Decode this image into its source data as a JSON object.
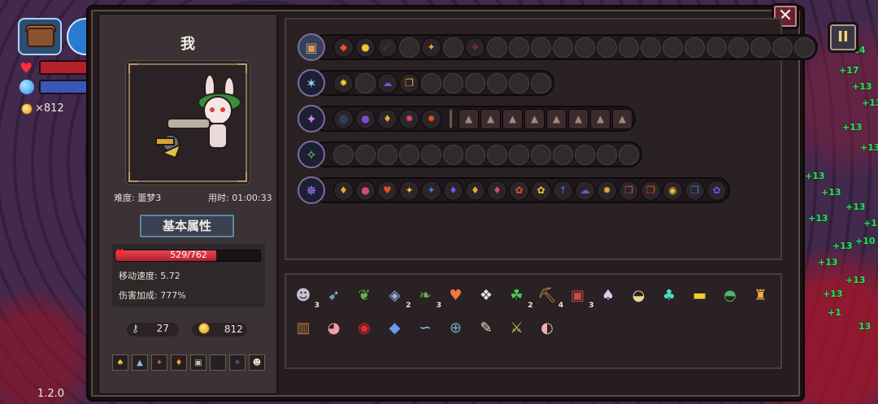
{
  "hud": {
    "gold_count": "×812",
    "version": "1.2.0"
  },
  "rain_numbers": [
    "+14",
    "+17",
    "+13",
    "+13",
    "+13",
    "+13",
    "+13",
    "+13",
    "+13",
    "+13",
    "+13",
    "+13",
    "+10",
    "+13",
    "+13",
    "+13",
    "+1",
    "13",
    "13"
  ],
  "panel": {
    "close_symbol": "✕",
    "pause_symbol": "II"
  },
  "player": {
    "name": "我",
    "difficulty": "难度: 噩梦3",
    "time": "用时: 01:00:33",
    "attr_title": "基本属性",
    "hp_text": "529/762",
    "hp_fraction": 0.694,
    "move_speed": "移动速度: 5.72",
    "damage_bonus": "伤害加成: 777%",
    "keys": "27",
    "gold": "812"
  },
  "weapon_rows": [
    {
      "weapon": "chest-icon",
      "slots": [
        "◆",
        "●",
        "☄",
        "",
        "✦",
        "",
        "✧",
        "",
        "",
        "",
        "",
        "",
        "",
        "",
        "",
        "",
        "",
        "",
        "",
        "",
        "",
        ""
      ]
    },
    {
      "weapon": "staff-frost-icon",
      "slots": [
        "✸",
        "",
        "☁",
        "❐",
        "",
        "",
        "",
        "",
        "",
        ""
      ]
    },
    {
      "weapon": "wand-shadow-icon",
      "slots": [
        "◎",
        "●",
        "♦",
        "✹",
        "✹"
      ],
      "buffs": [
        "▲",
        "▲",
        "▲",
        "▲",
        "▲",
        "▲",
        "▲",
        "▲"
      ]
    },
    {
      "weapon": "staff-nature-icon",
      "slots": [
        "",
        "",
        "",
        "",
        "",
        "",
        "",
        "",
        "",
        "",
        "",
        "",
        "",
        ""
      ]
    },
    {
      "weapon": "staff-arcane-icon",
      "slots": [
        "♦",
        "●",
        "♥",
        "✦",
        "✦",
        "♦",
        "♦",
        "♦",
        "✿",
        "✿",
        "↑",
        "☁",
        "✹",
        "❐",
        "❐",
        "◉",
        "❐",
        "✿"
      ]
    }
  ],
  "items": [
    {
      "icon": "skull-bomb-icon",
      "glyph": "☻",
      "count": "3"
    },
    {
      "icon": "arrow-icon",
      "glyph": "➶",
      "count": ""
    },
    {
      "icon": "green-pepper-icon",
      "glyph": "❦",
      "count": ""
    },
    {
      "icon": "crystal-icon",
      "glyph": "◈",
      "count": "2"
    },
    {
      "icon": "leaf-icon",
      "glyph": "❧",
      "count": "3"
    },
    {
      "icon": "heart-icon",
      "glyph": "♥",
      "count": ""
    },
    {
      "icon": "crystal-shard-icon",
      "glyph": "❖",
      "count": ""
    },
    {
      "icon": "clover-icon",
      "glyph": "☘",
      "count": "2"
    },
    {
      "icon": "pickaxe-icon",
      "glyph": "⛏",
      "count": "4"
    },
    {
      "icon": "crate-icon",
      "glyph": "▣",
      "count": "3"
    },
    {
      "icon": "mask-icon",
      "glyph": "♠",
      "count": ""
    },
    {
      "icon": "bread-icon",
      "glyph": "◒",
      "count": ""
    },
    {
      "icon": "feather-leaf-icon",
      "glyph": "♣",
      "count": ""
    },
    {
      "icon": "battery-icon",
      "glyph": "▬",
      "count": ""
    },
    {
      "icon": "hat-icon",
      "glyph": "◓",
      "count": ""
    },
    {
      "icon": "chalice-icon",
      "glyph": "♜",
      "count": ""
    },
    {
      "icon": "scroll-icon",
      "glyph": "▥",
      "count": ""
    },
    {
      "icon": "meat-icon",
      "glyph": "◕",
      "count": ""
    },
    {
      "icon": "red-eye-icon",
      "glyph": "◉",
      "count": ""
    },
    {
      "icon": "blue-gem-icon",
      "glyph": "◆",
      "count": ""
    },
    {
      "icon": "serpent-icon",
      "glyph": "∽",
      "count": ""
    },
    {
      "icon": "compass-icon",
      "glyph": "⊕",
      "count": ""
    },
    {
      "icon": "quill-icon",
      "glyph": "✎",
      "count": ""
    },
    {
      "icon": "sword-icon",
      "glyph": "⚔",
      "count": ""
    },
    {
      "icon": "ear-icon",
      "glyph": "◐",
      "count": ""
    }
  ],
  "mini_slots": [
    "♠",
    "▲",
    "✦",
    "♦",
    "▣",
    "",
    "✧",
    "☻"
  ],
  "colors": {
    "orb_fire": "#e8501e",
    "orb_gold": "#f2c233",
    "orb_blue": "#3c7ae0",
    "orb_purple": "#7d4fd6",
    "rain_green": "#29e05a"
  }
}
